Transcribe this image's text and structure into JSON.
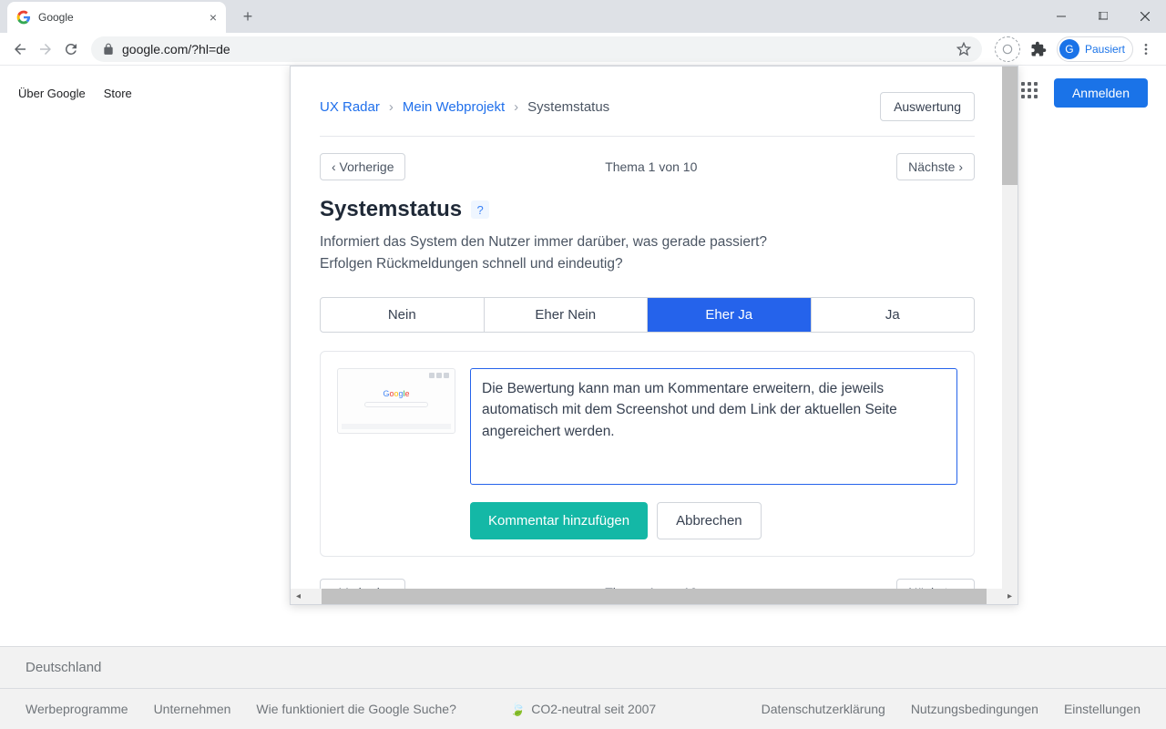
{
  "browser": {
    "tab_title": "Google",
    "url": "google.com/?hl=de",
    "profile_initial": "G",
    "profile_status": "Pausiert"
  },
  "google_page": {
    "links_left": {
      "about": "Über Google",
      "store": "Store"
    },
    "signin": "Anmelden",
    "footer": {
      "country": "Deutschland",
      "ads": "Werbeprogramme",
      "business": "Unternehmen",
      "how": "Wie funktioniert die Google Suche?",
      "carbon": "CO2-neutral seit 2007",
      "privacy": "Datenschutzerklärung",
      "terms": "Nutzungsbedingungen",
      "settings": "Einstellungen"
    }
  },
  "panel": {
    "breadcrumb": {
      "root": "UX Radar",
      "project": "Mein Webprojekt",
      "current": "Systemstatus"
    },
    "eval_button": "Auswertung",
    "pager": {
      "prev": "‹ Vorherige",
      "center": "Thema 1 von 10",
      "next": "Nächste ›"
    },
    "heading": "Systemstatus",
    "help": "?",
    "desc_line1": "Informiert das System den Nutzer immer darüber, was gerade passiert?",
    "desc_line2": "Erfolgen Rückmeldungen schnell und eindeutig?",
    "ratings": {
      "no": "Nein",
      "rather_no": "Eher Nein",
      "rather_yes": "Eher Ja",
      "yes": "Ja",
      "selected": "rather_yes"
    },
    "thumb_logo": "Google",
    "comment_text": "Die Bewertung kann man um Kommentare erweitern, die jeweils automatisch mit dem Screenshot und dem Link der aktuellen Seite angereichert werden.",
    "add_comment": "Kommentar hinzufügen",
    "cancel": "Abbrechen"
  }
}
